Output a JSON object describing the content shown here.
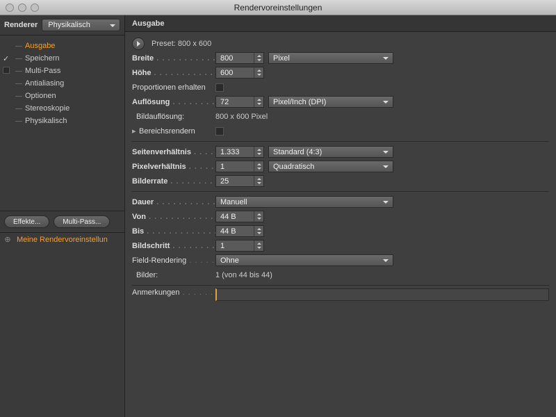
{
  "window": {
    "title": "Rendervoreinstellungen"
  },
  "sidebar": {
    "rendererLabel": "Renderer",
    "rendererValue": "Physikalisch",
    "items": [
      {
        "label": "Ausgabe",
        "active": true,
        "check": "none"
      },
      {
        "label": "Speichern",
        "active": false,
        "check": "on"
      },
      {
        "label": "Multi-Pass",
        "active": false,
        "check": "off"
      },
      {
        "label": "Antialiasing",
        "active": false,
        "check": "none"
      },
      {
        "label": "Optionen",
        "active": false,
        "check": "none"
      },
      {
        "label": "Stereoskopie",
        "active": false,
        "check": "none"
      },
      {
        "label": "Physikalisch",
        "active": false,
        "check": "none"
      }
    ],
    "effectsBtn": "Effekte...",
    "multiPassBtn": "Multi-Pass...",
    "presetName": "Meine Rendervoreinstellun"
  },
  "panel": {
    "title": "Ausgabe",
    "presetLine": "Preset: 800 x 600",
    "width": {
      "label": "Breite",
      "value": "800",
      "unit": "Pixel"
    },
    "height": {
      "label": "Höhe",
      "value": "600"
    },
    "keepProp": {
      "label": "Proportionen erhalten"
    },
    "res": {
      "label": "Auflösung",
      "value": "72",
      "unit": "Pixel/Inch (DPI)"
    },
    "imgRes": {
      "label": "Bildauflösung:",
      "value": "800 x 600 Pixel"
    },
    "regionRender": {
      "label": "Bereichsrendern"
    },
    "aspect": {
      "label": "Seitenverhältnis",
      "value": "1.333",
      "unit": "Standard (4:3)"
    },
    "pixelAspect": {
      "label": "Pixelverhältnis",
      "value": "1",
      "unit": "Quadratisch"
    },
    "fps": {
      "label": "Bilderrate",
      "value": "25"
    },
    "duration": {
      "label": "Dauer",
      "value": "Manuell"
    },
    "from": {
      "label": "Von",
      "value": "44 B"
    },
    "to": {
      "label": "Bis",
      "value": "44 B"
    },
    "step": {
      "label": "Bildschritt",
      "value": "1"
    },
    "fieldRender": {
      "label": "Field-Rendering",
      "value": "Ohne"
    },
    "frames": {
      "label": "Bilder:",
      "value": "1 (von 44 bis 44)"
    },
    "notes": {
      "label": "Anmerkungen"
    }
  }
}
